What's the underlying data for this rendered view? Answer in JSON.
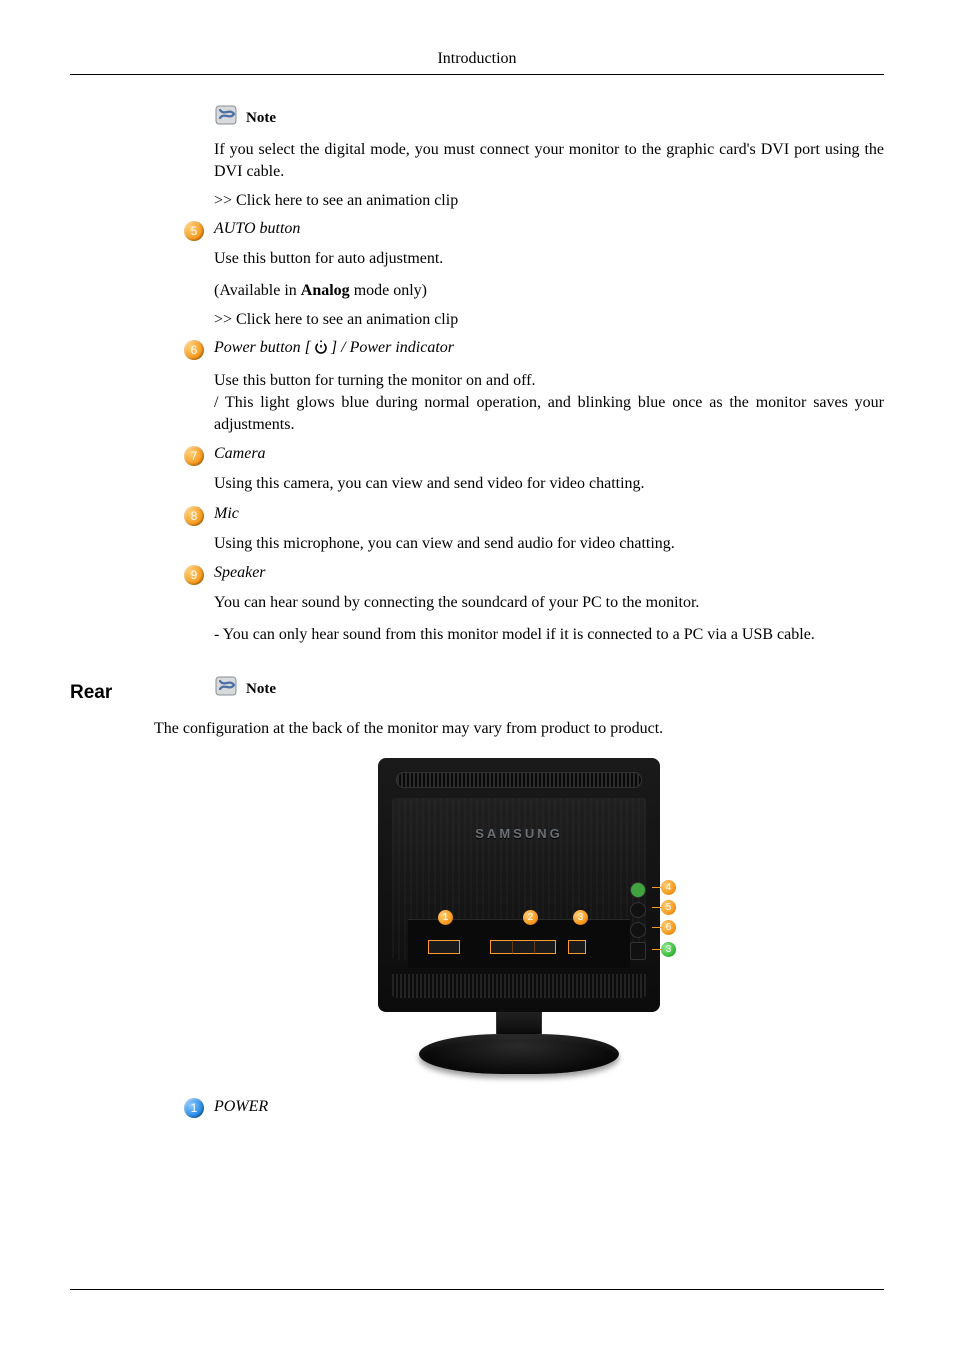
{
  "header": {
    "title": "Introduction"
  },
  "note_label": "Note",
  "brand": "SAMSUNG",
  "analog_word": "Analog",
  "note1_body": "If you select the digital mode, you must connect your monitor to the graphic card's DVI port using the DVI cable.",
  "link_anim": ">> Click here to see an animation clip",
  "items": {
    "i5": {
      "num": "5",
      "head": "AUTO button",
      "body1": "Use this button for auto adjustment.",
      "body2_pre": "(Available in ",
      "body2_post": " mode only)"
    },
    "i6": {
      "num": "6",
      "head_pre": "Power button [",
      "head_post": "] / Power indicator",
      "body": "Use this button for turning the monitor on and off.\n/ This light glows blue during normal operation, and blinking blue once as the monitor saves your adjustments."
    },
    "i7": {
      "num": "7",
      "head": "Camera",
      "body": "Using this camera, you can view and send video for video chatting."
    },
    "i8": {
      "num": "8",
      "head": "Mic",
      "body": "Using this microphone, you can view and send audio for video chatting."
    },
    "i9": {
      "num": "9",
      "head": "Speaker",
      "body1": "You can hear sound by connecting the soundcard of your PC to the monitor.",
      "body2": "- You can only hear sound from this monitor model if it is connected to a PC via a USB cable."
    }
  },
  "rear": {
    "heading": "Rear",
    "desc": "The configuration at the back of the monitor may vary from product to product.",
    "labels": {
      "l1": "1",
      "l2": "2",
      "l3": "3",
      "l4": "4",
      "l5": "5",
      "l6": "6",
      "l7": "3"
    },
    "item1": {
      "num": "1",
      "head": "POWER"
    }
  }
}
